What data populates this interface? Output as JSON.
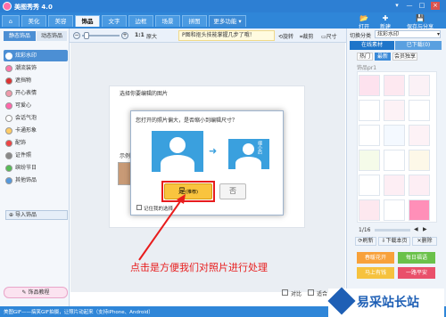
{
  "app": {
    "title": "美图秀秀 4.0"
  },
  "tabs": [
    {
      "label": "美化"
    },
    {
      "label": "美容"
    },
    {
      "label": "饰品"
    },
    {
      "label": "文字"
    },
    {
      "label": "边框"
    },
    {
      "label": "场景"
    },
    {
      "label": "拼图"
    },
    {
      "label": "更多功能 ▾"
    }
  ],
  "top_buttons": [
    {
      "label": "打开"
    },
    {
      "label": "新建"
    },
    {
      "label": "保存与分享"
    }
  ],
  "toolbar": {
    "zoom_label": "1:1",
    "original_label": "原大",
    "hint": "P图和抠头技能掌握几步了哦！",
    "rotate_label": "旋转",
    "crop_label": "裁剪",
    "size_label": "尺寸"
  },
  "left_panel": {
    "tabs": [
      "静态饰品",
      "动态饰品"
    ],
    "items": [
      {
        "label": "炫彩水印"
      },
      {
        "label": "潮流装饰"
      },
      {
        "label": "遮挡物"
      },
      {
        "label": "开心表情"
      },
      {
        "label": "可爱心"
      },
      {
        "label": "会话气泡"
      },
      {
        "label": "卡通形象"
      },
      {
        "label": "配饰"
      },
      {
        "label": "证件照"
      },
      {
        "label": "缤纷节日"
      },
      {
        "label": "其他饰品"
      }
    ],
    "import_label": "导入饰品",
    "tutorial_label": "饰品教程"
  },
  "canvas": {
    "prompt": "选择你要编辑的图片",
    "recent_label": "示例图"
  },
  "dialog": {
    "question": "您打开的照片偏大，是否缩小到编辑尺寸？",
    "yes_label": "是",
    "yes_note": "(推荐)",
    "no_label": "否",
    "remember_label": "记住我的选择",
    "thumb_label": "缩小后"
  },
  "annotation": {
    "text": "点击是方便我们对照片进行处理"
  },
  "right_panel": {
    "category_label": "切换分类",
    "category_value": "炫彩水印",
    "tabs": [
      "在线素材",
      "已下载(0)"
    ],
    "subtabs": [
      "热门",
      "最新",
      "会员独享"
    ],
    "section_label": "饰品pr1",
    "page": "1/16",
    "actions": [
      "刷新",
      "下载本页",
      "删除"
    ],
    "chips": [
      "春暖花开",
      "每日福语",
      "马上有钱",
      "一路平安"
    ]
  },
  "status": {
    "text": "美图GIF——搞笑GIF拍摄，让照片动起来（支持iPhone、Android）",
    "compare_label": "对比",
    "fit_label": "适合"
  },
  "watermark": {
    "text": "易采站长站"
  }
}
